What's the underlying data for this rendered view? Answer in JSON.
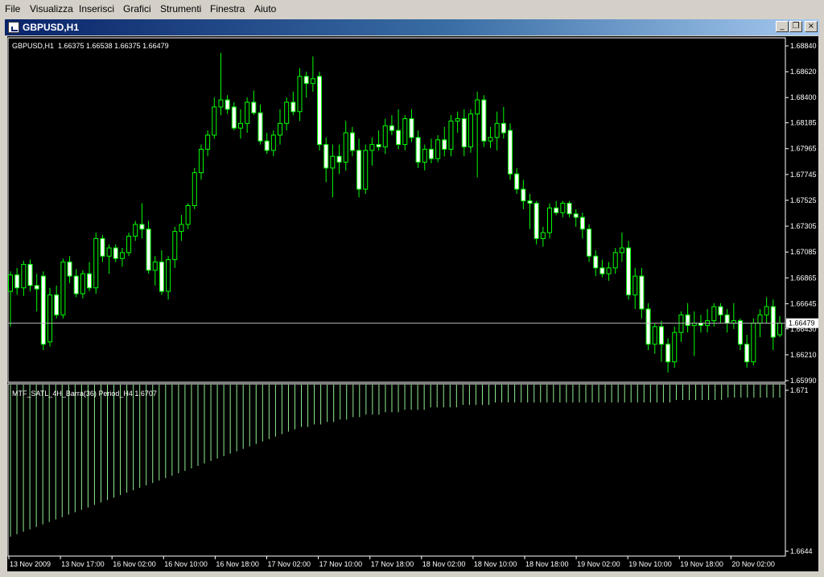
{
  "menu": {
    "items": [
      "File",
      "Visualizza",
      "Inserisci",
      "Grafici",
      "Strumenti",
      "Finestra",
      "Aiuto"
    ]
  },
  "window": {
    "title": "GBPUSD,H1",
    "buttons": {
      "minimize": "_",
      "restore": "❐",
      "close": "×"
    }
  },
  "chart_data": [
    {
      "type": "candlestick",
      "title": "GBPUSD,H1  1.66375 1.66538 1.66375 1.66479",
      "symbol": "GBPUSD",
      "timeframe": "H1",
      "last_ohlc": {
        "open": 1.66375,
        "high": 1.66538,
        "low": 1.66375,
        "close": 1.66479
      },
      "current_price_label": "1.66479",
      "y_ticks": [
        "1.68840",
        "1.68620",
        "1.68400",
        "1.68185",
        "1.67965",
        "1.67745",
        "1.67525",
        "1.67305",
        "1.67085",
        "1.66865",
        "1.66645",
        "1.66430",
        "1.66210",
        "1.65990"
      ],
      "ylim": [
        1.6599,
        1.6884
      ],
      "series_color": "#00ff00",
      "up_candle_color": "#000000",
      "down_candle_color": "#ffffff",
      "grid": false,
      "candles": [
        {
          "o": 1.6675,
          "h": 1.6692,
          "l": 1.6645,
          "c": 1.6689
        },
        {
          "o": 1.6689,
          "h": 1.6695,
          "l": 1.6672,
          "c": 1.6678
        },
        {
          "o": 1.6678,
          "h": 1.6701,
          "l": 1.6671,
          "c": 1.6698
        },
        {
          "o": 1.6698,
          "h": 1.6702,
          "l": 1.6675,
          "c": 1.668
        },
        {
          "o": 1.668,
          "h": 1.669,
          "l": 1.6658,
          "c": 1.6677
        },
        {
          "o": 1.6688,
          "h": 1.6692,
          "l": 1.6625,
          "c": 1.663
        },
        {
          "o": 1.6632,
          "h": 1.6678,
          "l": 1.6628,
          "c": 1.6672
        },
        {
          "o": 1.6672,
          "h": 1.668,
          "l": 1.6652,
          "c": 1.6655
        },
        {
          "o": 1.6655,
          "h": 1.6703,
          "l": 1.6652,
          "c": 1.67
        },
        {
          "o": 1.67,
          "h": 1.6705,
          "l": 1.6682,
          "c": 1.6688
        },
        {
          "o": 1.6688,
          "h": 1.6694,
          "l": 1.667,
          "c": 1.6673
        },
        {
          "o": 1.6673,
          "h": 1.6693,
          "l": 1.6669,
          "c": 1.669
        },
        {
          "o": 1.669,
          "h": 1.67,
          "l": 1.6675,
          "c": 1.6678
        },
        {
          "o": 1.6678,
          "h": 1.6725,
          "l": 1.6673,
          "c": 1.672
        },
        {
          "o": 1.672,
          "h": 1.6723,
          "l": 1.67,
          "c": 1.6705
        },
        {
          "o": 1.6705,
          "h": 1.6715,
          "l": 1.669,
          "c": 1.6712
        },
        {
          "o": 1.6712,
          "h": 1.6715,
          "l": 1.67,
          "c": 1.6703
        },
        {
          "o": 1.6703,
          "h": 1.6712,
          "l": 1.6696,
          "c": 1.6708
        },
        {
          "o": 1.6708,
          "h": 1.6725,
          "l": 1.6705,
          "c": 1.6722
        },
        {
          "o": 1.6722,
          "h": 1.6735,
          "l": 1.6718,
          "c": 1.6732
        },
        {
          "o": 1.6732,
          "h": 1.675,
          "l": 1.672,
          "c": 1.6728
        },
        {
          "o": 1.6728,
          "h": 1.6735,
          "l": 1.669,
          "c": 1.6693
        },
        {
          "o": 1.6693,
          "h": 1.6705,
          "l": 1.668,
          "c": 1.67
        },
        {
          "o": 1.67,
          "h": 1.671,
          "l": 1.6672,
          "c": 1.6675
        },
        {
          "o": 1.6675,
          "h": 1.6705,
          "l": 1.6668,
          "c": 1.6702
        },
        {
          "o": 1.6702,
          "h": 1.673,
          "l": 1.6695,
          "c": 1.6726
        },
        {
          "o": 1.6726,
          "h": 1.674,
          "l": 1.6718,
          "c": 1.6732
        },
        {
          "o": 1.6732,
          "h": 1.675,
          "l": 1.6728,
          "c": 1.6748
        },
        {
          "o": 1.6748,
          "h": 1.678,
          "l": 1.6745,
          "c": 1.6776
        },
        {
          "o": 1.6776,
          "h": 1.68,
          "l": 1.677,
          "c": 1.6796
        },
        {
          "o": 1.6796,
          "h": 1.6812,
          "l": 1.679,
          "c": 1.6808
        },
        {
          "o": 1.6808,
          "h": 1.684,
          "l": 1.6805,
          "c": 1.6832
        },
        {
          "o": 1.6832,
          "h": 1.6878,
          "l": 1.6825,
          "c": 1.6838
        },
        {
          "o": 1.6838,
          "h": 1.6842,
          "l": 1.6826,
          "c": 1.683
        },
        {
          "o": 1.6832,
          "h": 1.6836,
          "l": 1.6812,
          "c": 1.6814
        },
        {
          "o": 1.6814,
          "h": 1.683,
          "l": 1.6805,
          "c": 1.6818
        },
        {
          "o": 1.6818,
          "h": 1.684,
          "l": 1.681,
          "c": 1.6836
        },
        {
          "o": 1.6836,
          "h": 1.6846,
          "l": 1.6825,
          "c": 1.6827
        },
        {
          "o": 1.6827,
          "h": 1.6834,
          "l": 1.68,
          "c": 1.6803
        },
        {
          "o": 1.6803,
          "h": 1.681,
          "l": 1.6792,
          "c": 1.6795
        },
        {
          "o": 1.6795,
          "h": 1.6812,
          "l": 1.679,
          "c": 1.6808
        },
        {
          "o": 1.6808,
          "h": 1.683,
          "l": 1.68,
          "c": 1.6818
        },
        {
          "o": 1.6818,
          "h": 1.684,
          "l": 1.6812,
          "c": 1.6836
        },
        {
          "o": 1.6836,
          "h": 1.6845,
          "l": 1.6825,
          "c": 1.6828
        },
        {
          "o": 1.6828,
          "h": 1.6865,
          "l": 1.682,
          "c": 1.6858
        },
        {
          "o": 1.6858,
          "h": 1.6862,
          "l": 1.684,
          "c": 1.6852
        },
        {
          "o": 1.6852,
          "h": 1.6875,
          "l": 1.6845,
          "c": 1.6856
        },
        {
          "o": 1.6858,
          "h": 1.6862,
          "l": 1.6795,
          "c": 1.68
        },
        {
          "o": 1.68,
          "h": 1.6806,
          "l": 1.6768,
          "c": 1.678
        },
        {
          "o": 1.678,
          "h": 1.68,
          "l": 1.6755,
          "c": 1.679
        },
        {
          "o": 1.679,
          "h": 1.68,
          "l": 1.6775,
          "c": 1.6785
        },
        {
          "o": 1.6785,
          "h": 1.682,
          "l": 1.6778,
          "c": 1.681
        },
        {
          "o": 1.681,
          "h": 1.6815,
          "l": 1.679,
          "c": 1.6795
        },
        {
          "o": 1.6795,
          "h": 1.6805,
          "l": 1.6755,
          "c": 1.6762
        },
        {
          "o": 1.6762,
          "h": 1.68,
          "l": 1.6758,
          "c": 1.6795
        },
        {
          "o": 1.6795,
          "h": 1.6806,
          "l": 1.6782,
          "c": 1.68
        },
        {
          "o": 1.68,
          "h": 1.6812,
          "l": 1.6795,
          "c": 1.6798
        },
        {
          "o": 1.6798,
          "h": 1.6822,
          "l": 1.6792,
          "c": 1.6816
        },
        {
          "o": 1.6816,
          "h": 1.6825,
          "l": 1.6808,
          "c": 1.6812
        },
        {
          "o": 1.6812,
          "h": 1.683,
          "l": 1.6796,
          "c": 1.68
        },
        {
          "o": 1.68,
          "h": 1.6825,
          "l": 1.6795,
          "c": 1.6822
        },
        {
          "o": 1.6822,
          "h": 1.683,
          "l": 1.6802,
          "c": 1.6806
        },
        {
          "o": 1.6806,
          "h": 1.6812,
          "l": 1.678,
          "c": 1.6785
        },
        {
          "o": 1.6785,
          "h": 1.68,
          "l": 1.6778,
          "c": 1.6796
        },
        {
          "o": 1.6796,
          "h": 1.6805,
          "l": 1.6784,
          "c": 1.6788
        },
        {
          "o": 1.6788,
          "h": 1.6808,
          "l": 1.6785,
          "c": 1.6804
        },
        {
          "o": 1.6804,
          "h": 1.6815,
          "l": 1.679,
          "c": 1.6796
        },
        {
          "o": 1.6796,
          "h": 1.6825,
          "l": 1.679,
          "c": 1.682
        },
        {
          "o": 1.682,
          "h": 1.6828,
          "l": 1.681,
          "c": 1.6822
        },
        {
          "o": 1.6822,
          "h": 1.683,
          "l": 1.679,
          "c": 1.6798
        },
        {
          "o": 1.6798,
          "h": 1.683,
          "l": 1.6793,
          "c": 1.6826
        },
        {
          "o": 1.6826,
          "h": 1.6845,
          "l": 1.6772,
          "c": 1.6838
        },
        {
          "o": 1.6838,
          "h": 1.6842,
          "l": 1.6798,
          "c": 1.6803
        },
        {
          "o": 1.6803,
          "h": 1.6815,
          "l": 1.6797,
          "c": 1.6806
        },
        {
          "o": 1.6806,
          "h": 1.6828,
          "l": 1.6795,
          "c": 1.6818
        },
        {
          "o": 1.6818,
          "h": 1.6832,
          "l": 1.6805,
          "c": 1.681
        },
        {
          "o": 1.6812,
          "h": 1.6818,
          "l": 1.677,
          "c": 1.6775
        },
        {
          "o": 1.6775,
          "h": 1.678,
          "l": 1.6758,
          "c": 1.6762
        },
        {
          "o": 1.6762,
          "h": 1.677,
          "l": 1.6745,
          "c": 1.6752
        },
        {
          "o": 1.6752,
          "h": 1.6758,
          "l": 1.6728,
          "c": 1.675
        },
        {
          "o": 1.675,
          "h": 1.6752,
          "l": 1.6715,
          "c": 1.672
        },
        {
          "o": 1.672,
          "h": 1.673,
          "l": 1.6713,
          "c": 1.6725
        },
        {
          "o": 1.6725,
          "h": 1.675,
          "l": 1.672,
          "c": 1.6746
        },
        {
          "o": 1.6746,
          "h": 1.6752,
          "l": 1.674,
          "c": 1.6742
        },
        {
          "o": 1.6742,
          "h": 1.6752,
          "l": 1.6738,
          "c": 1.675
        },
        {
          "o": 1.675,
          "h": 1.6752,
          "l": 1.6738,
          "c": 1.6741
        },
        {
          "o": 1.6741,
          "h": 1.6745,
          "l": 1.673,
          "c": 1.6738
        },
        {
          "o": 1.6738,
          "h": 1.6742,
          "l": 1.672,
          "c": 1.6728
        },
        {
          "o": 1.6728,
          "h": 1.6732,
          "l": 1.67,
          "c": 1.6705
        },
        {
          "o": 1.6705,
          "h": 1.671,
          "l": 1.6688,
          "c": 1.6695
        },
        {
          "o": 1.6695,
          "h": 1.6702,
          "l": 1.6687,
          "c": 1.669
        },
        {
          "o": 1.669,
          "h": 1.67,
          "l": 1.6684,
          "c": 1.6695
        },
        {
          "o": 1.6695,
          "h": 1.6712,
          "l": 1.669,
          "c": 1.6708
        },
        {
          "o": 1.6708,
          "h": 1.6725,
          "l": 1.67,
          "c": 1.6712
        },
        {
          "o": 1.6712,
          "h": 1.6718,
          "l": 1.6668,
          "c": 1.6672
        },
        {
          "o": 1.6672,
          "h": 1.6695,
          "l": 1.666,
          "c": 1.6688
        },
        {
          "o": 1.6688,
          "h": 1.6695,
          "l": 1.6652,
          "c": 1.666
        },
        {
          "o": 1.666,
          "h": 1.6665,
          "l": 1.6625,
          "c": 1.663
        },
        {
          "o": 1.663,
          "h": 1.6648,
          "l": 1.6622,
          "c": 1.6645
        },
        {
          "o": 1.6645,
          "h": 1.665,
          "l": 1.6615,
          "c": 1.663
        },
        {
          "o": 1.663,
          "h": 1.6635,
          "l": 1.6606,
          "c": 1.6615
        },
        {
          "o": 1.6615,
          "h": 1.6645,
          "l": 1.661,
          "c": 1.664
        },
        {
          "o": 1.664,
          "h": 1.6658,
          "l": 1.6632,
          "c": 1.6655
        },
        {
          "o": 1.6655,
          "h": 1.6665,
          "l": 1.664,
          "c": 1.6646
        },
        {
          "o": 1.6646,
          "h": 1.6658,
          "l": 1.662,
          "c": 1.6648
        },
        {
          "o": 1.6648,
          "h": 1.6655,
          "l": 1.664,
          "c": 1.6646
        },
        {
          "o": 1.6646,
          "h": 1.666,
          "l": 1.664,
          "c": 1.665
        },
        {
          "o": 1.665,
          "h": 1.6665,
          "l": 1.6645,
          "c": 1.6662
        },
        {
          "o": 1.6662,
          "h": 1.6665,
          "l": 1.6648,
          "c": 1.6655
        },
        {
          "o": 1.6655,
          "h": 1.666,
          "l": 1.664,
          "c": 1.6648
        },
        {
          "o": 1.6648,
          "h": 1.6665,
          "l": 1.6643,
          "c": 1.665
        },
        {
          "o": 1.665,
          "h": 1.6652,
          "l": 1.6625,
          "c": 1.663
        },
        {
          "o": 1.663,
          "h": 1.6638,
          "l": 1.661,
          "c": 1.6615
        },
        {
          "o": 1.6615,
          "h": 1.6652,
          "l": 1.6612,
          "c": 1.6648
        },
        {
          "o": 1.6648,
          "h": 1.666,
          "l": 1.6636,
          "c": 1.6655
        },
        {
          "o": 1.6655,
          "h": 1.667,
          "l": 1.6648,
          "c": 1.6662
        },
        {
          "o": 1.6662,
          "h": 1.6668,
          "l": 1.6625,
          "c": 1.6636
        },
        {
          "o": 1.6638,
          "h": 1.6654,
          "l": 1.6636,
          "c": 1.6648
        }
      ]
    },
    {
      "type": "bar",
      "title": "MTF_SATL_4H_Barra(36) Period_H4 1.6707",
      "y_ticks": [
        "1.671",
        "1.6644"
      ],
      "ylim": [
        1.6644,
        1.671
      ],
      "baseline": 1.6644,
      "series_color": "#90ee90",
      "values": [
        1.665,
        1.6651,
        1.6652,
        1.6653,
        1.6654,
        1.6655,
        1.6656,
        1.6657,
        1.6658,
        1.6659,
        1.666,
        1.6661,
        1.6662,
        1.6663,
        1.6664,
        1.6665,
        1.6666,
        1.6667,
        1.6668,
        1.6669,
        1.667,
        1.6671,
        1.6672,
        1.6673,
        1.6674,
        1.6675,
        1.6676,
        1.6677,
        1.6678,
        1.6679,
        1.668,
        1.6681,
        1.6682,
        1.6683,
        1.6684,
        1.6685,
        1.6686,
        1.6687,
        1.6688,
        1.6689,
        1.669,
        1.6691,
        1.6692,
        1.6693,
        1.6694,
        1.6695,
        1.6695,
        1.6696,
        1.6696,
        1.6697,
        1.6697,
        1.6698,
        1.6698,
        1.6699,
        1.6699,
        1.67,
        1.67,
        1.67,
        1.6701,
        1.6701,
        1.6701,
        1.6702,
        1.6702,
        1.6702,
        1.6702,
        1.6703,
        1.6703,
        1.6703,
        1.6703,
        1.6703,
        1.6704,
        1.6704,
        1.6704,
        1.6704,
        1.6704,
        1.6705,
        1.6705,
        1.6705,
        1.6705,
        1.6705,
        1.6705,
        1.6705,
        1.6705,
        1.6705,
        1.6705,
        1.6705,
        1.6705,
        1.6705,
        1.6705,
        1.6705,
        1.6705,
        1.6705,
        1.6705,
        1.6705,
        1.6705,
        1.6705,
        1.6705,
        1.6705,
        1.6705,
        1.6705,
        1.6705,
        1.6705,
        1.6705,
        1.6706,
        1.6706,
        1.6706,
        1.6706,
        1.6706,
        1.6706,
        1.6706,
        1.6706,
        1.6707,
        1.6707,
        1.6707,
        1.6707,
        1.6707,
        1.6707,
        1.6707,
        1.6707,
        1.6707
      ]
    }
  ],
  "x_ticks": [
    "13 Nov 2009",
    "13 Nov 17:00",
    "16 Nov 02:00",
    "16 Nov 10:00",
    "16 Nov 18:00",
    "17 Nov 02:00",
    "17 Nov 10:00",
    "17 Nov 18:00",
    "18 Nov 02:00",
    "18 Nov 10:00",
    "18 Nov 18:00",
    "19 Nov 02:00",
    "19 Nov 10:00",
    "19 Nov 18:00",
    "20 Nov 02:00"
  ]
}
